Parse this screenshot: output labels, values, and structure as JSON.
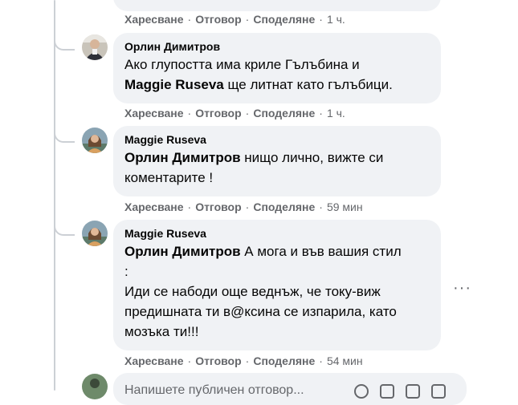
{
  "labels": {
    "like": "Харесване",
    "reply": "Отговор",
    "share": "Споделяне",
    "separator": "·"
  },
  "comments": [
    {
      "time": "1 ч."
    },
    {
      "author": "Орлин Димитров",
      "line1": "Ако глупостта има криле Гълъбина и",
      "mention": "Maggie Ruseva",
      "line2_rest": " ще литнат като гълъбици.",
      "time": "1 ч."
    },
    {
      "author": "Maggie Ruseva",
      "mention": "Орлин Димитров",
      "line1_rest": " нищо лично, вижте си",
      "line2": "коментарите !",
      "time": "59 мин"
    },
    {
      "author": "Maggie Ruseva",
      "mention": "Орлин Димитров",
      "line1_rest": " А мога и във вашия стил",
      "line2": ":",
      "line3": "Иди се набоди още веднъж, че току-виж",
      "line4": "предишната ти в@ксина се изпарила, като",
      "line5": "мозъка ти!!!",
      "time": "54 мин"
    }
  ],
  "reply_input": {
    "placeholder": "Напишете публичен отговор..."
  },
  "more_options": "···",
  "colors": {
    "bubble": "#f0f2f5",
    "meta": "#65676b",
    "text": "#050505",
    "thread": "#ccd0d5"
  }
}
